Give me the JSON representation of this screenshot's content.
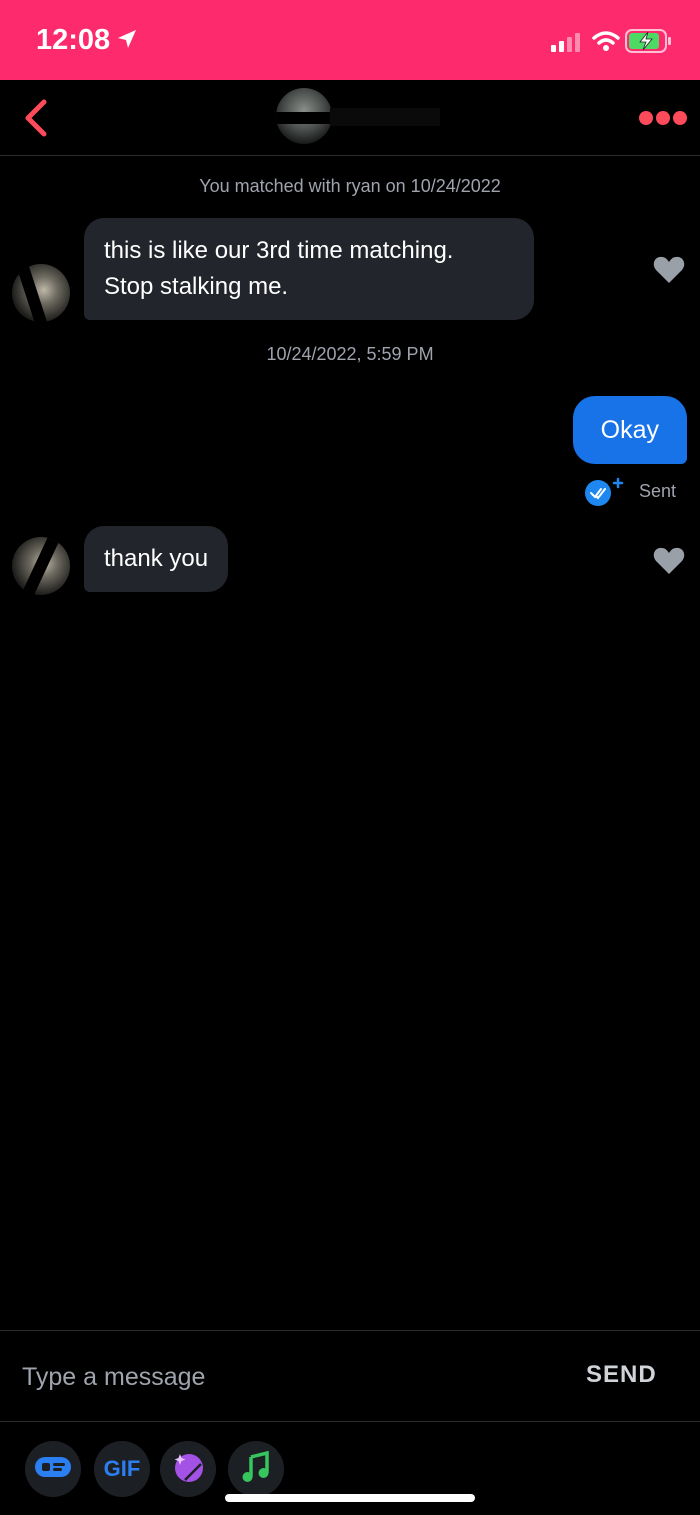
{
  "status_bar": {
    "time": "12:08",
    "location_icon": "location-arrow-icon",
    "signal_icon": "cellular-signal-icon",
    "wifi_icon": "wifi-icon",
    "battery_icon": "battery-charging-icon",
    "background_color": "#fe2a6e"
  },
  "header": {
    "back_icon": "chevron-left-icon",
    "more_icon": "more-dots-icon",
    "accent_color": "#fd4b5b"
  },
  "chat": {
    "match_note": "You matched with ryan on 10/24/2022",
    "messages": [
      {
        "direction": "incoming",
        "lines": [
          "this is like our 3rd time matching.",
          "Stop stalking me."
        ]
      },
      {
        "direction": "outgoing",
        "text": "Okay",
        "status": "Sent"
      },
      {
        "direction": "incoming",
        "text": "thank you"
      }
    ],
    "timestamp": "10/24/2022, 5:59 PM",
    "incoming_bubble_color": "#22252b",
    "outgoing_bubble_color": "#1873e8"
  },
  "composer": {
    "placeholder": "Type a message",
    "value": "",
    "send_label": "SEND"
  },
  "toolbar": {
    "buttons": [
      {
        "icon": "sticker-card-icon"
      },
      {
        "label": "GIF"
      },
      {
        "icon": "sparkle-moon-icon"
      },
      {
        "icon": "music-note-icon"
      }
    ]
  }
}
